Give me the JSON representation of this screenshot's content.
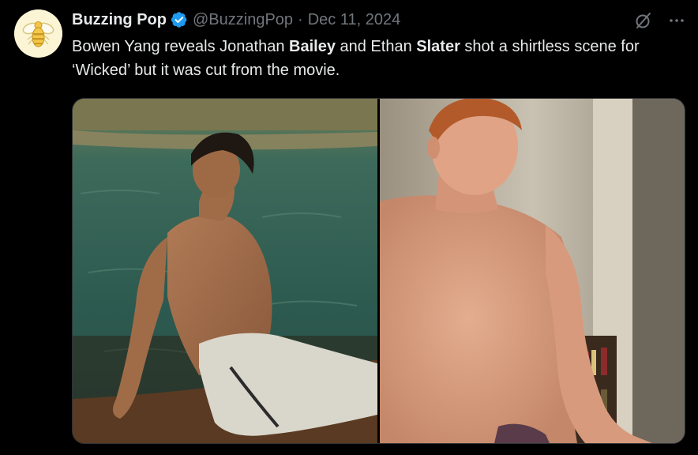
{
  "tweet": {
    "display_name": "Buzzing Pop",
    "handle": "@BuzzingPop",
    "separator": "·",
    "date": "Dec 11, 2024",
    "text": {
      "part1": "Bowen Yang reveals Jonathan ",
      "bold1": "Bailey",
      "part2": " and Ethan ",
      "bold2": "Slater",
      "part3": " shot a shirtless scene for ‘Wicked’ but it was cut from the movie."
    },
    "icons": {
      "avatar": "bee-logo-icon",
      "verified": "verified-badge-icon",
      "grok": "grok-icon",
      "more": "more-options-icon"
    }
  },
  "media": {
    "images": [
      {
        "name": "photo-left",
        "description_visible": false
      },
      {
        "name": "photo-right",
        "description_visible": false
      }
    ]
  },
  "colors": {
    "background": "#000000",
    "text_primary": "#e7e9ea",
    "text_secondary": "#71767b",
    "verified_blue": "#1d9bf0",
    "border": "#2f3336"
  }
}
